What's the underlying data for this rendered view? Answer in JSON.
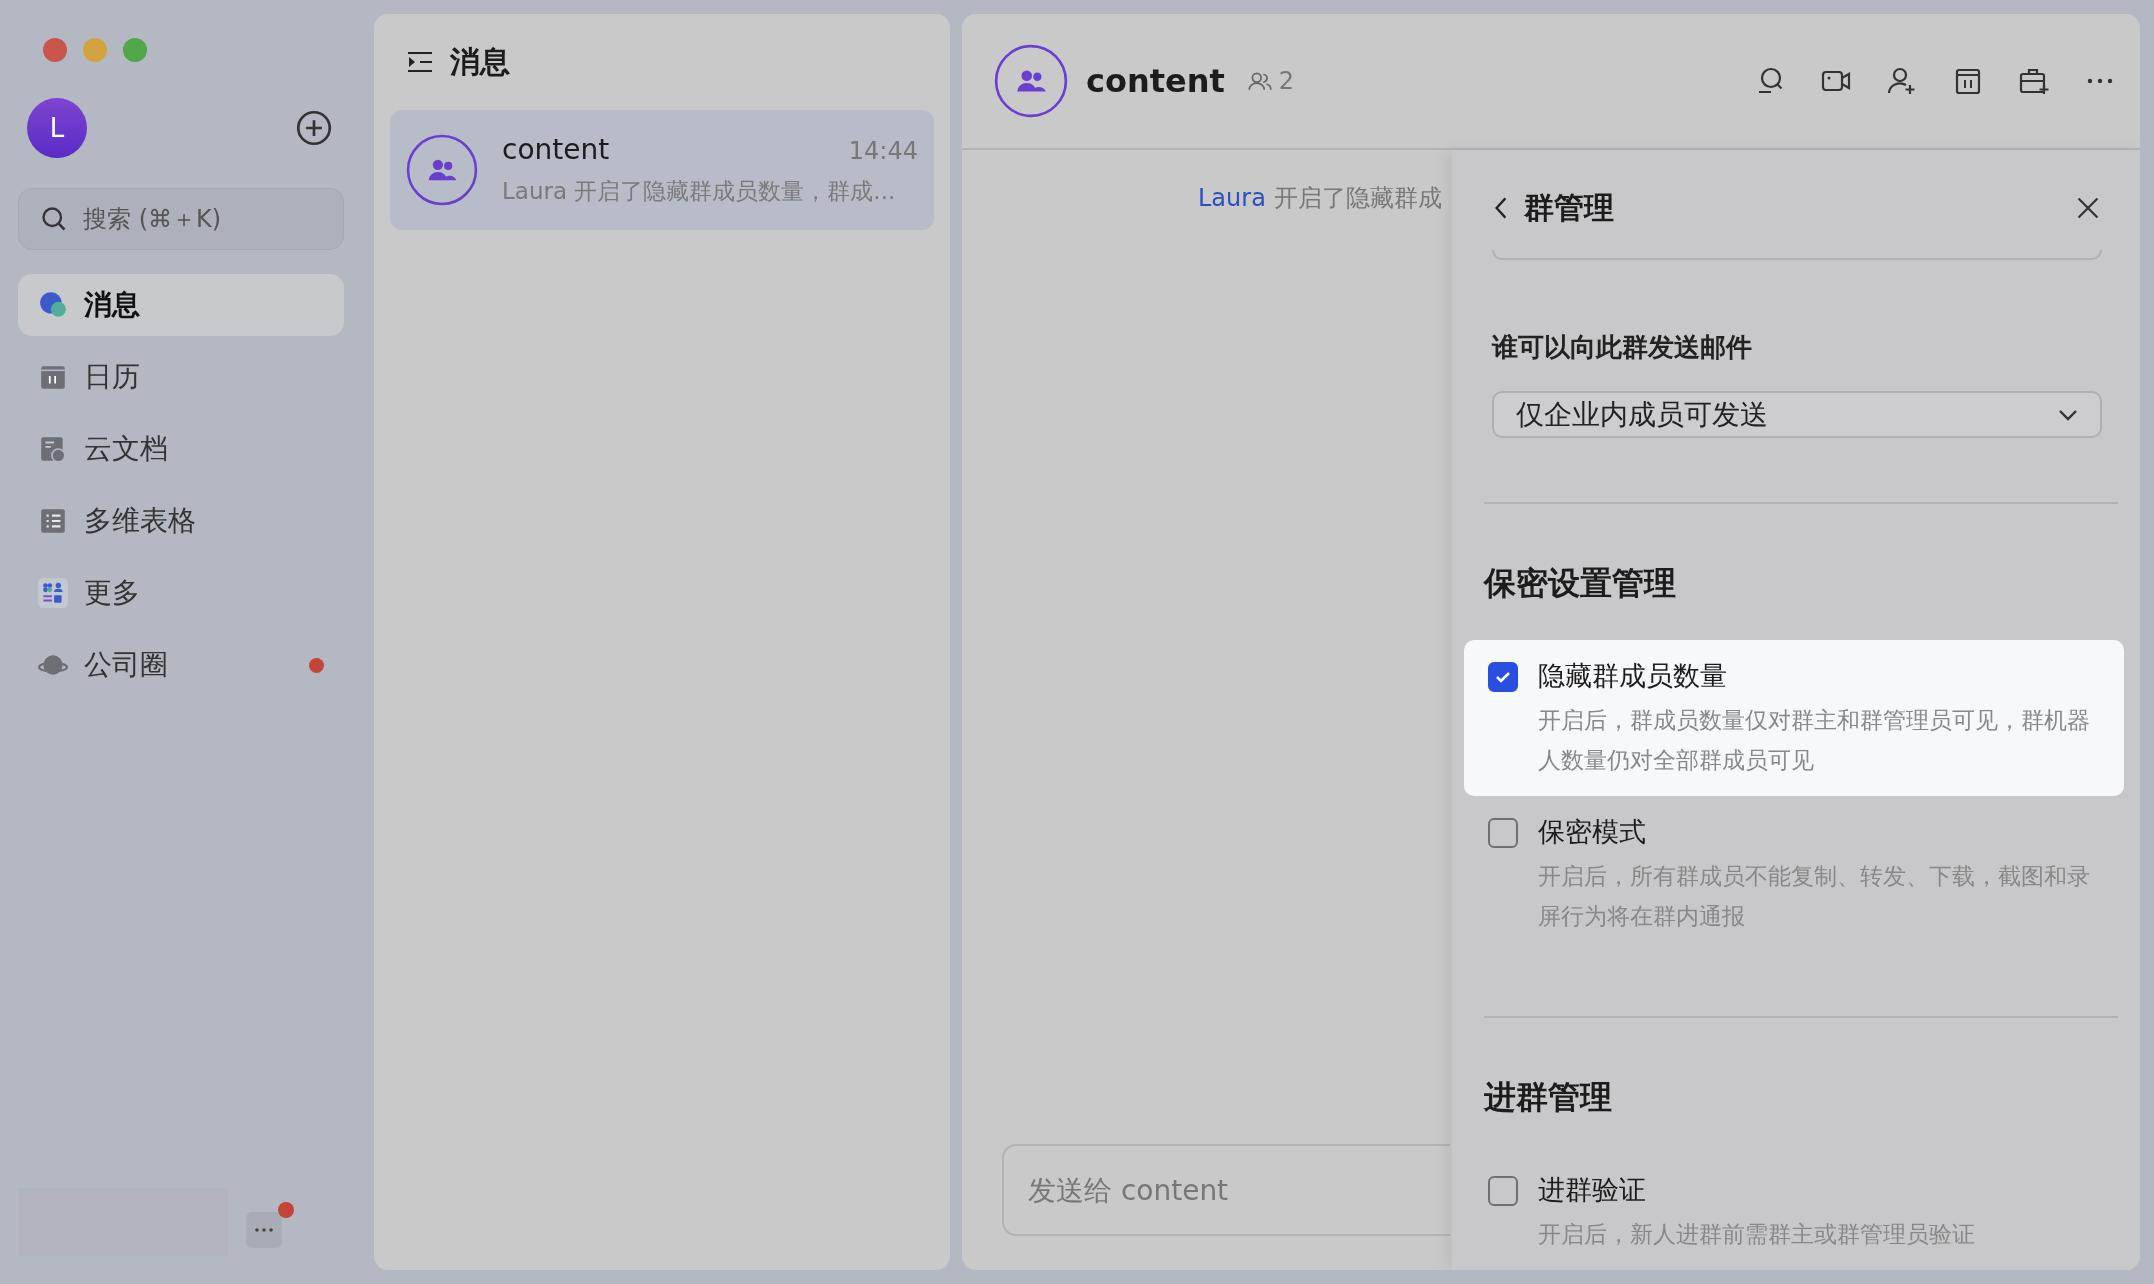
{
  "sidebar": {
    "avatar_letter": "L",
    "search": {
      "placeholder": "搜索 (⌘＋K)"
    },
    "items": [
      {
        "kind": "messages",
        "label": "消息",
        "selected": true,
        "unread": false
      },
      {
        "kind": "calendar",
        "label": "日历",
        "selected": false,
        "unread": false
      },
      {
        "kind": "docs",
        "label": "云文档",
        "selected": false,
        "unread": false
      },
      {
        "kind": "base",
        "label": "多维表格",
        "selected": false,
        "unread": false
      },
      {
        "kind": "apps",
        "label": "更多",
        "selected": false,
        "unread": false
      },
      {
        "kind": "moments",
        "label": "公司圈",
        "selected": false,
        "unread": true
      }
    ],
    "more_unread": true
  },
  "chat_list": {
    "title": "消息",
    "items": [
      {
        "name": "content",
        "time": "14:44",
        "preview": "Laura 开启了隐藏群成员数量，群成...",
        "selected": true
      }
    ]
  },
  "chat": {
    "name": "content",
    "member_count": "2",
    "system_message": {
      "actor": "Laura",
      "text": "开启了隐藏群成"
    },
    "composer": {
      "placeholder": "发送给 content"
    }
  },
  "drawer": {
    "title": "群管理",
    "email_setting": {
      "label": "谁可以向此群发送邮件",
      "value": "仅企业内成员可发送"
    },
    "sections": [
      {
        "title": "保密设置管理",
        "options": [
          {
            "label": "隐藏群成员数量",
            "description": "开启后，群成员数量仅对群主和群管理员可见，群机器人数量仍对全部群成员可见",
            "checked": true,
            "highlighted": true
          },
          {
            "label": "保密模式",
            "description": "开启后，所有群成员不能复制、转发、下载，截图和录屏行为将在群内通报",
            "checked": false,
            "highlighted": false
          }
        ]
      },
      {
        "title": "进群管理",
        "options": [
          {
            "label": "进群验证",
            "description": "开启后，新人进群前需群主或群管理员验证",
            "checked": false,
            "highlighted": false
          }
        ]
      }
    ]
  }
}
